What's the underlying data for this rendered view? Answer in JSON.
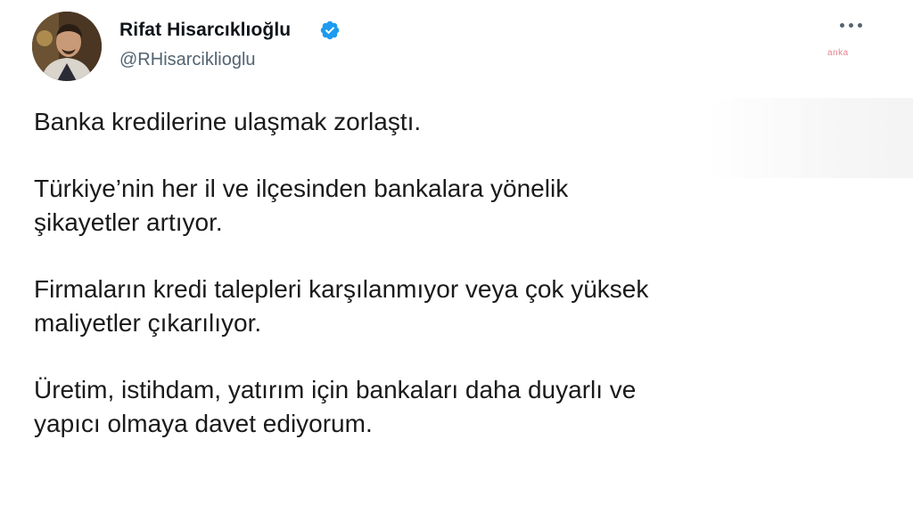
{
  "tweet": {
    "author": {
      "name": "Rifat Hisarcıklıoğlu",
      "handle": "@RHisarciklioglu",
      "verified": true,
      "avatar_icon": "profile-photo"
    },
    "more_icon": "more-horizontal-icon",
    "watermark": "anka",
    "paragraphs": [
      "Banka kredilerine ulaşmak zorlaştı.",
      "Türkiye’nin her il ve ilçesinden bankalara yönelik\nşikayetler artıyor.",
      "Firmaların kredi talepleri karşılanmıyor veya çok yüksek\nmaliyetler çıkarılıyor.",
      "Üretim, istihdam, yatırım için bankaları daha duyarlı ve\nyapıcı olmaya davet ediyorum."
    ]
  },
  "colors": {
    "verified_badge": "#1d9bf0",
    "handle_text": "#536471",
    "name_text": "#0f1419",
    "watermark": "#e05a6a"
  }
}
